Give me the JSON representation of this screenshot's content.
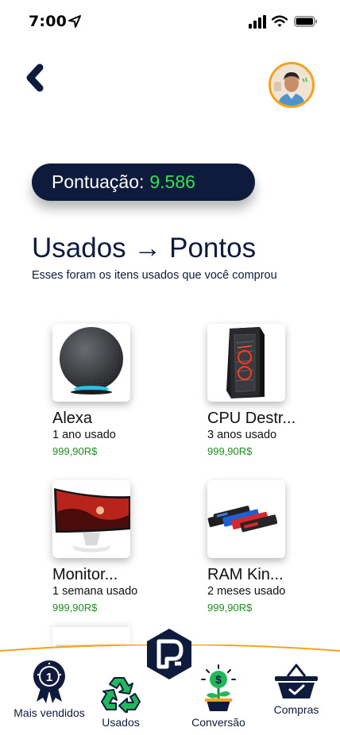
{
  "status_bar": {
    "time": "7:00"
  },
  "header": {
    "back_icon": "chevron-left-icon",
    "avatar_icon": "user-avatar"
  },
  "score": {
    "label": "Pontuação:",
    "value": "9.586",
    "value_color": "#2ee44a"
  },
  "page": {
    "title": "Usados → Pontos",
    "subtitle": "Esses foram os itens usados que você comprou"
  },
  "products": [
    {
      "name": "Alexa",
      "age": "1 ano usado",
      "price": "999,90R$",
      "image": "smart-speaker"
    },
    {
      "name": "CPU Destr...",
      "age": "3 anos usado",
      "price": "999,90R$",
      "image": "pc-case"
    },
    {
      "name": "Monitor...",
      "age": "1 semana usado",
      "price": "999,90R$",
      "image": "curved-monitor"
    },
    {
      "name": "RAM Kin...",
      "age": "2 meses usado",
      "price": "999,90R$",
      "image": "ram-sticks"
    }
  ],
  "nav": {
    "items": [
      {
        "label": "Mais vendidos",
        "icon": "medal-icon"
      },
      {
        "label": "Usados",
        "icon": "recycle-icon"
      },
      {
        "label": "Conversão",
        "icon": "money-plant-icon"
      },
      {
        "label": "Compras",
        "icon": "basket-icon"
      }
    ],
    "home_icon": "logo-hexagon-icon",
    "accent": "#f4a21d",
    "primary": "#0f1b3d"
  }
}
